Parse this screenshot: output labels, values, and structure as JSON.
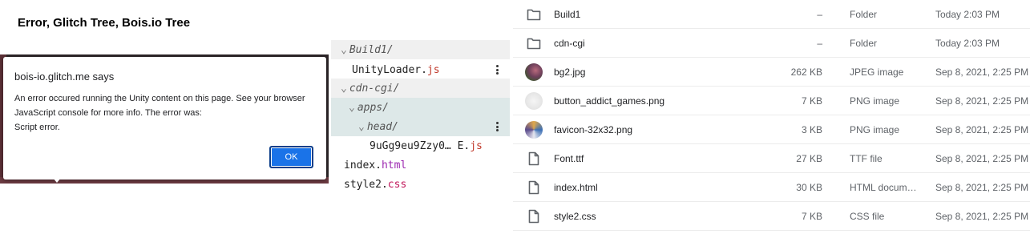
{
  "page": {
    "title": "Error, Glitch Tree, Bois.io Tree"
  },
  "alert": {
    "title": "bois-io.glitch.me says",
    "message_lines": [
      "An error occured running the Unity content on this page. See your browser",
      "JavaScript console for more info. The error was:",
      "Script error."
    ],
    "ok_label": "OK"
  },
  "tree": {
    "build_folder": "Build1/",
    "unity_loader_base": "UnityLoader.",
    "unity_loader_ext": "js",
    "cdn_folder": "cdn-cgi/",
    "apps_folder": "apps/",
    "head_folder": "head/",
    "head_file_base": "9uGg9eu9Zzy0… E.",
    "head_file_ext": "js",
    "index_base": "index.",
    "index_ext": "html",
    "style_base": "style2.",
    "style_ext": "css"
  },
  "files": [
    {
      "name": "Build1",
      "size": "–",
      "type": "Folder",
      "modified": "Today 2:03 PM",
      "icon": "folder-icon"
    },
    {
      "name": "cdn-cgi",
      "size": "–",
      "type": "Folder",
      "modified": "Today 2:03 PM",
      "icon": "folder-icon"
    },
    {
      "name": "bg2.jpg",
      "size": "262 KB",
      "type": "JPEG image",
      "modified": "Sep 8, 2021, 2:25 PM",
      "icon": "image-thumbnail"
    },
    {
      "name": "button_addict_games.png",
      "size": "7 KB",
      "type": "PNG image",
      "modified": "Sep 8, 2021, 2:25 PM",
      "icon": "image-thumbnail"
    },
    {
      "name": "favicon-32x32.png",
      "size": "3 KB",
      "type": "PNG image",
      "modified": "Sep 8, 2021, 2:25 PM",
      "icon": "image-thumbnail"
    },
    {
      "name": "Font.ttf",
      "size": "27 KB",
      "type": "TTF file",
      "modified": "Sep 8, 2021, 2:25 PM",
      "icon": "file-icon"
    },
    {
      "name": "index.html",
      "size": "30 KB",
      "type": "HTML docum…",
      "modified": "Sep 8, 2021, 2:25 PM",
      "icon": "file-icon"
    },
    {
      "name": "style2.css",
      "size": "7 KB",
      "type": "CSS file",
      "modified": "Sep 8, 2021, 2:25 PM",
      "icon": "file-icon"
    }
  ],
  "colors": {
    "accent": "#1a73e8",
    "js": "#c0392b",
    "html": "#9c27b0",
    "css": "#c2185b"
  }
}
